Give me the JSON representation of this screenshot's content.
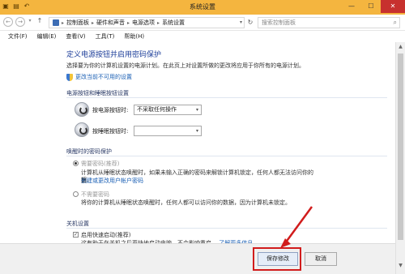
{
  "window": {
    "title": "系统设置"
  },
  "titlebar_icons": [
    "folder-icon",
    "save-icon",
    "undo-icon"
  ],
  "address": {
    "crumbs": [
      "控制面板",
      "硬件和声音",
      "电源选项",
      "系统设置"
    ],
    "search_placeholder": "搜索控制面板"
  },
  "menu": [
    "文件(F)",
    "编辑(E)",
    "查看(V)",
    "工具(T)",
    "帮助(H)"
  ],
  "page": {
    "title": "定义电源按钮并启用密码保护",
    "description": "选择要为你的计算机设置的电源计划。在此页上对设置所做的更改将应用于你所有的电源计划。",
    "change_link": "更改当前不可用的设置"
  },
  "power_section": {
    "title": "电源按钮和睡眠按钮设置",
    "power_label": "按电源按钮时:",
    "power_value": "不采取任何操作",
    "sleep_label": "按睡眠按钮时:",
    "sleep_value": ""
  },
  "wake_section": {
    "title": "唤醒时的密码保护",
    "require": {
      "label": "需要密码(推荐)",
      "desc": "计算机从睡眠状态唤醒时，如果未输入正确的密码来解锁计算机锁定，任何人都无法访问你的数",
      "desc2": "据。",
      "link": "创建或更改用户帐户密码"
    },
    "norequire": {
      "label": "不需要密码",
      "desc": "将你的计算机从睡眠状态唤醒时，任何人都可以访问你的数据，因为计算机未锁定。"
    }
  },
  "shutdown_section": {
    "title": "关机设置",
    "fast_startup": "启用快速启动(推荐)",
    "fast_desc": "这有助于在关机之后更快地启动电脑。不会影响重启。",
    "learn_more": "了解更多信息"
  },
  "buttons": {
    "save": "保存修改",
    "cancel": "取消"
  },
  "colors": {
    "titlebar": "#f4b53f",
    "accent_link": "#1a5fb4",
    "title_blue": "#1e3f9a",
    "highlight": "#d11c1c"
  }
}
